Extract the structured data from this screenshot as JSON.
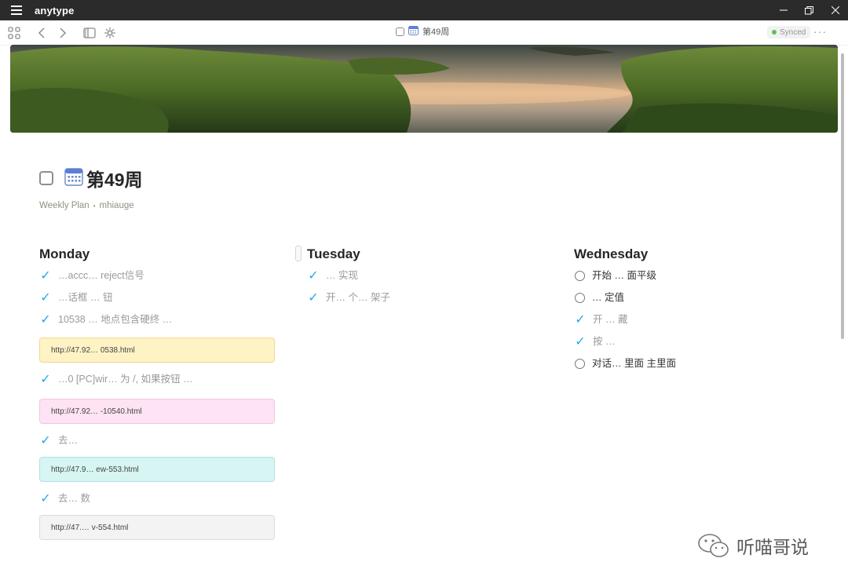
{
  "window": {
    "app_name": "anytype"
  },
  "toolbar": {
    "breadcrumb": "第49周",
    "sync_status": "Synced",
    "sync_color": "#5cc14f",
    "more": "···"
  },
  "page": {
    "title": "第49周",
    "type": "Weekly Plan",
    "author": "mhiauge",
    "separator": "•"
  },
  "columns": {
    "monday": {
      "heading": "Monday",
      "item1": "…accc… reject信号",
      "item2": "…话框 … 钮",
      "item3": "10538 … 地点包含硬终 …",
      "link1": "http://47.92… 0538.html",
      "item4": "…0 [PC]wir… 为 /, 如果按钮 …",
      "link2": "http://47.92… -10540.html",
      "item5": "去…",
      "link3": "http://47.9… ew-553.html",
      "item6": "去… 数",
      "link4": "http://47.… v-554.html"
    },
    "tuesday": {
      "heading": "Tuesday",
      "item1": "… 实现",
      "item2": "开… 个… 架子"
    },
    "wednesday": {
      "heading": "Wednesday",
      "item1": "开始 … 面平级",
      "item2": "… 定值",
      "item3": "开 … 藏",
      "item4": "按 …",
      "item5": "对话… 里面 主里面"
    }
  },
  "watermark": {
    "text": "听喵哥说"
  }
}
